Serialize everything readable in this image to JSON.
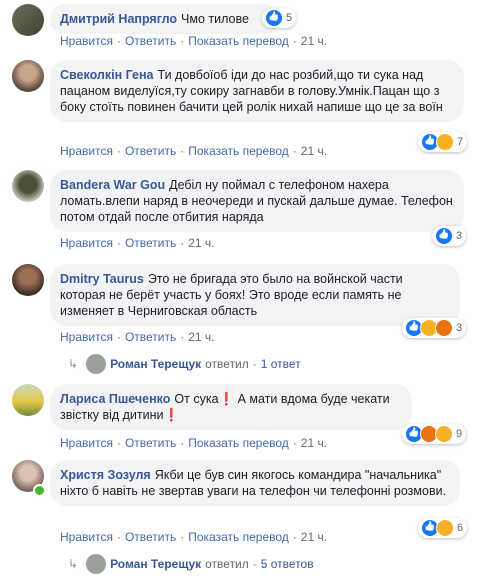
{
  "comments": [
    {
      "author": "Дмитрий Напрягло",
      "text": "Чмо тилове",
      "actions": {
        "like": "Нравится",
        "reply": "Ответить",
        "translate": "Показать перевод",
        "time": "21 ч."
      },
      "reactions": {
        "types": [
          "like"
        ],
        "count": "5"
      }
    },
    {
      "author": "Свеколкін Гена",
      "text": "Ти довбоїоб іди до нас розбий,що ти сука над пацаном виделуїся,ту сокиру загнавби в голову.Умнік.Пацан що з боку стоїть повинен бачити цей ролік нихай напише що це за воїн",
      "actions": {
        "like": "Нравится",
        "reply": "Ответить",
        "translate": "Показать перевод",
        "time": "21 ч."
      },
      "reactions": {
        "types": [
          "like",
          "sad"
        ],
        "count": "7"
      }
    },
    {
      "author": "Bandera War Gou",
      "text": "Дебіл ну поймал с телефоном нахера ломать.влепи наряд в неочереди и пускай дальше думае. Телефон потом отдай после отбития наряда",
      "actions": {
        "like": "Нравится",
        "reply": "Ответить",
        "time": "21 ч."
      },
      "reactions": {
        "types": [
          "like"
        ],
        "count": "3"
      }
    },
    {
      "author": "Dmitry Taurus",
      "text": "Это не бригада это было на войнской части которая не берёт участь у боях! Это вроде если память не изменяет в Черниговская область",
      "actions": {
        "like": "Нравится",
        "reply": "Ответить",
        "time": "21 ч."
      },
      "reactions": {
        "types": [
          "like",
          "haha",
          "angry"
        ],
        "count": "3"
      },
      "reply_summary": {
        "name": "Роман Терещук",
        "verb": "ответил",
        "count": "1 ответ"
      }
    },
    {
      "author": "Лариса Пшеченко",
      "text": "От сука❗ А мати вдома буде чекати звістку від дитини❗",
      "actions": {
        "like": "Нравится",
        "reply": "Ответить",
        "translate": "Показать перевод",
        "time": "21 ч."
      },
      "reactions": {
        "types": [
          "like",
          "angry",
          "sad"
        ],
        "count": "9"
      }
    },
    {
      "author": "Христя Зозуля",
      "text": "Якби це був син якогось командира \"начальника\" ніхто б навіть не звертав уваги на телефон чи телефонні розмови.",
      "actions": {
        "like": "Нравится",
        "reply": "Ответить",
        "translate": "Показать перевод",
        "time": "21 ч."
      },
      "reactions": {
        "types": [
          "like",
          "sad"
        ],
        "count": "6"
      },
      "reply_summary": {
        "name": "Роман Терещук",
        "verb": "ответил",
        "count": "5 ответов"
      }
    }
  ],
  "colors": {
    "link": "#385898",
    "action": "#4267b2",
    "bubble": "#f2f3f5",
    "like": "#1877f2"
  }
}
